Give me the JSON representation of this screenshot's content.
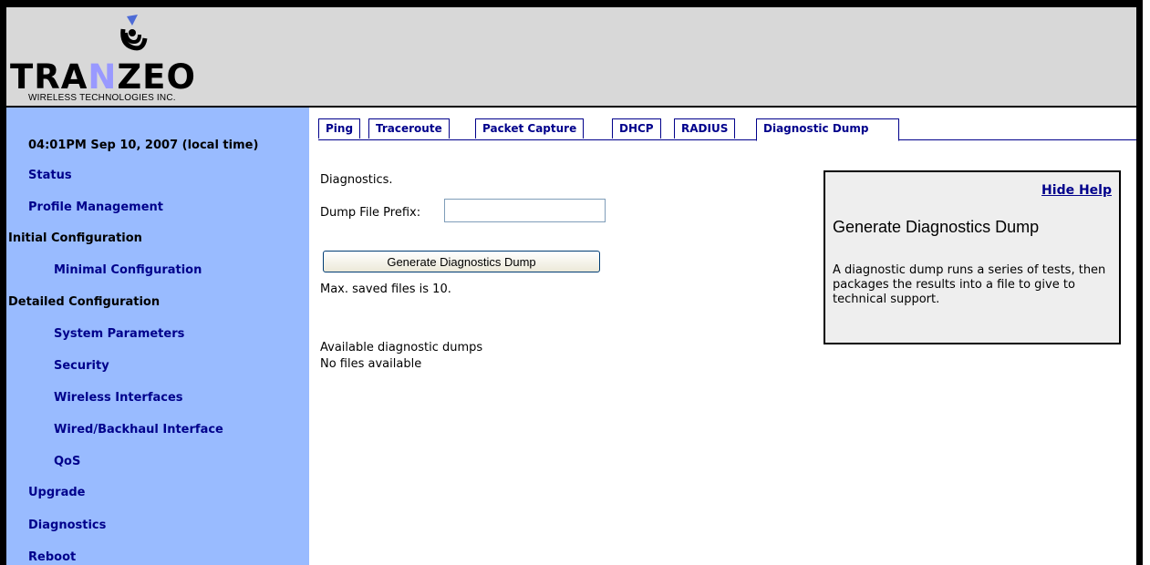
{
  "logo": {
    "brand_prefix": "TRA",
    "brand_n": "N",
    "brand_suffix": "ZEO",
    "subtitle": "WIRELESS TECHNOLOGIES INC."
  },
  "sidebar": {
    "clock": "04:01PM Sep 10, 2007 (local time)",
    "items": [
      {
        "label": "Status"
      },
      {
        "label": "Profile Management"
      },
      {
        "label": "Initial Configuration"
      },
      {
        "label": "Minimal Configuration"
      },
      {
        "label": "Detailed Configuration"
      },
      {
        "label": "System Parameters"
      },
      {
        "label": "Security"
      },
      {
        "label": "Wireless Interfaces"
      },
      {
        "label": "Wired/Backhaul Interface"
      },
      {
        "label": "QoS"
      },
      {
        "label": "Upgrade"
      },
      {
        "label": "Diagnostics"
      },
      {
        "label": "Reboot"
      }
    ]
  },
  "tabs": [
    {
      "label": "Ping"
    },
    {
      "label": "Traceroute"
    },
    {
      "label": "Packet Capture"
    },
    {
      "label": "DHCP"
    },
    {
      "label": "RADIUS"
    },
    {
      "label": "Diagnostic Dump",
      "active": true
    }
  ],
  "main": {
    "heading": "Diagnostics.",
    "prefix_label": "Dump File Prefix:",
    "prefix_value": "",
    "generate_button": "Generate Diagnostics Dump",
    "max_files": "Max. saved files is 10.",
    "available_title": "Available diagnostic dumps",
    "available_status": "No files available"
  },
  "help": {
    "hide_link": "Hide Help",
    "title": "Generate Diagnostics Dump",
    "body": "A diagnostic dump runs a series of tests, then packages the results into a file to give to technical support."
  },
  "colors": {
    "sidebar_bg": "#99bbff",
    "header_bg": "#d8d8d8",
    "link": "#00008b",
    "help_bg": "#eeeeee"
  }
}
